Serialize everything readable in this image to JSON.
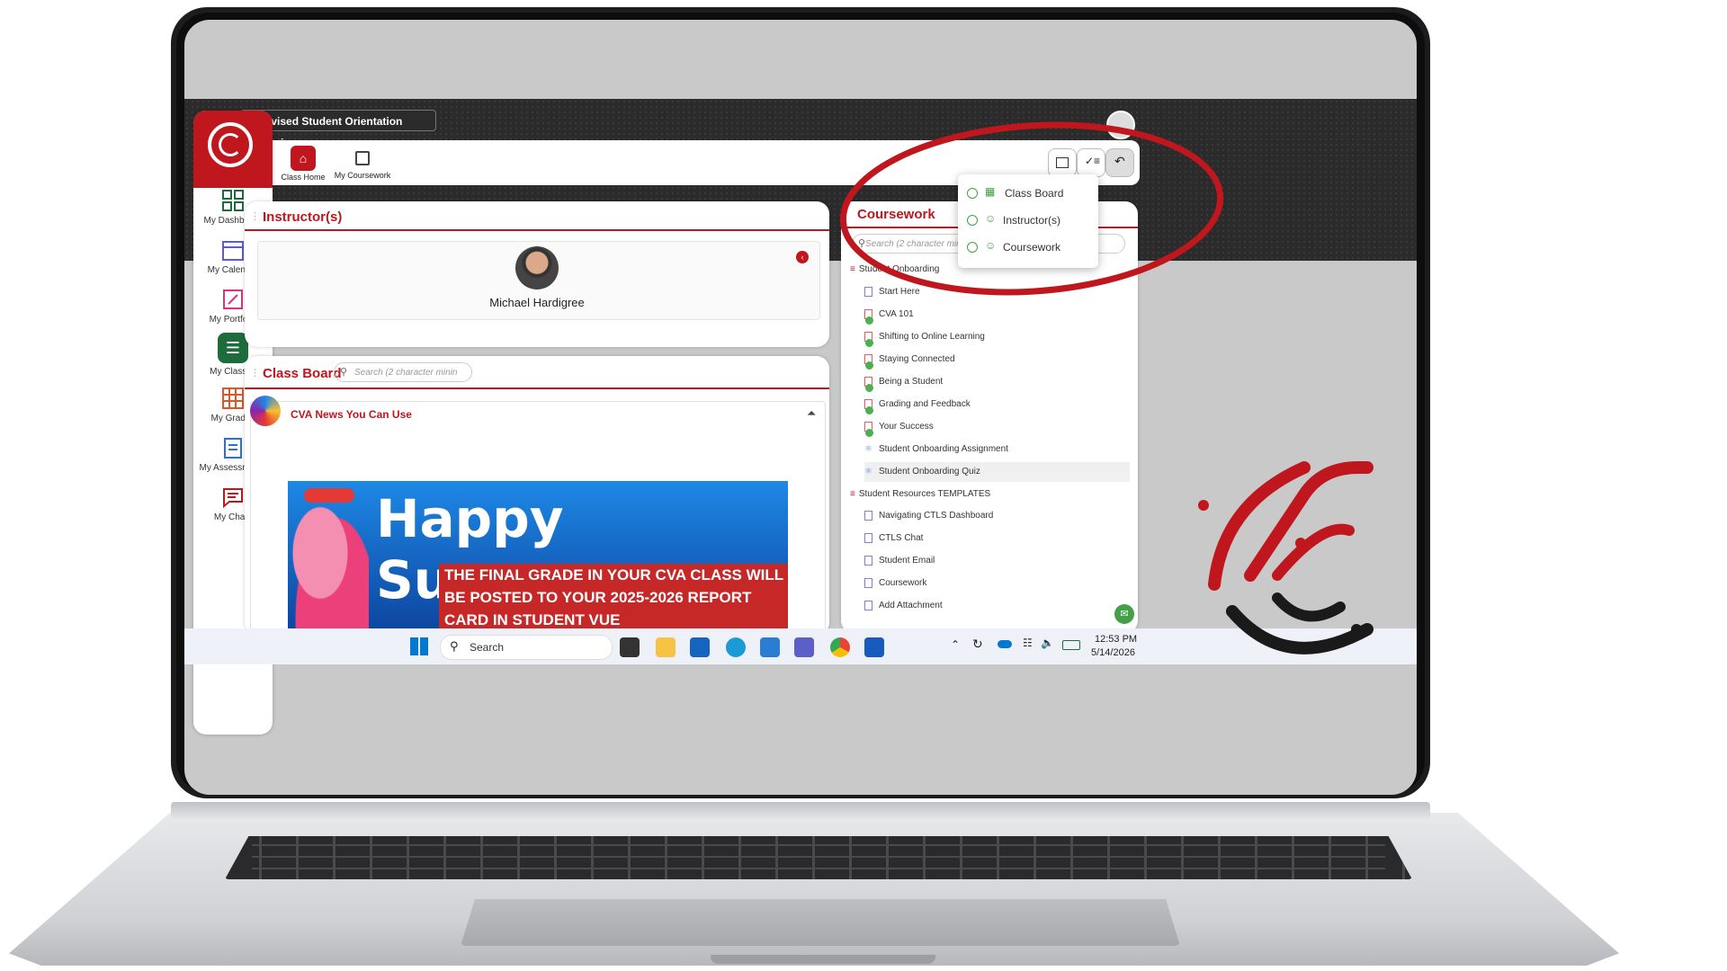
{
  "app": {
    "class_selector": "Revised Student Orientation Preview",
    "colors": {
      "brand_red": "#c0161d",
      "accent_green": "#1e6b3c",
      "check_green": "#43a047"
    }
  },
  "sidebar": {
    "items": [
      {
        "label": "My Dashboard",
        "icon": "dashboard-icon"
      },
      {
        "label": "My Calendar",
        "icon": "calendar-icon"
      },
      {
        "label": "My Portfolio",
        "icon": "portfolio-icon"
      },
      {
        "label": "My Classes",
        "icon": "classes-icon",
        "active": true
      },
      {
        "label": "My Grades",
        "icon": "grades-icon"
      },
      {
        "label": "My Assessments",
        "icon": "assessments-icon"
      },
      {
        "label": "My Chats",
        "icon": "chats-icon"
      }
    ]
  },
  "topnav": {
    "class_home": "Class Home",
    "my_coursework": "My Coursework"
  },
  "layout_menu": {
    "items": [
      "Class Board",
      "Instructor(s)",
      "Coursework"
    ]
  },
  "instructors": {
    "title": "Instructor(s)",
    "name": "Michael Hardigree"
  },
  "class_board": {
    "title": "Class Board",
    "search_placeholder": "Search (2 character minin",
    "post_title": "CVA News You Can Use",
    "banner_heading": "Happy Summer",
    "banner_text": "THE FINAL GRADE IN YOUR CVA CLASS WILL BE POSTED TO YOUR 2025-2026 REPORT CARD IN STUDENT VUE"
  },
  "coursework": {
    "title": "Coursework",
    "search_placeholder": "Search (2 character minin",
    "folders": [
      {
        "label": "Student Onboarding",
        "items": [
          {
            "label": "Start Here",
            "type": "page"
          },
          {
            "label": "CVA 101",
            "type": "lesson",
            "done": true
          },
          {
            "label": "Shifting to Online Learning",
            "type": "lesson",
            "done": true
          },
          {
            "label": "Staying Connected",
            "type": "lesson",
            "done": true
          },
          {
            "label": "Being a Student",
            "type": "lesson",
            "done": true
          },
          {
            "label": "Grading and Feedback",
            "type": "lesson",
            "done": true
          },
          {
            "label": "Your Success",
            "type": "lesson",
            "done": true
          },
          {
            "label": "Student Onboarding Assignment",
            "type": "assignment"
          },
          {
            "label": "Student Onboarding Quiz",
            "type": "assignment",
            "selected": true
          }
        ]
      },
      {
        "label": "Student Resources TEMPLATES",
        "items": [
          {
            "label": "Navigating CTLS Dashboard",
            "type": "page"
          },
          {
            "label": "CTLS Chat",
            "type": "page"
          },
          {
            "label": "Student Email",
            "type": "page"
          },
          {
            "label": "Coursework",
            "type": "page"
          },
          {
            "label": "Add Attachment",
            "type": "page"
          }
        ]
      }
    ]
  },
  "taskbar": {
    "search_label": "Search",
    "time": "12:53 PM",
    "date": "5/14/2026"
  }
}
